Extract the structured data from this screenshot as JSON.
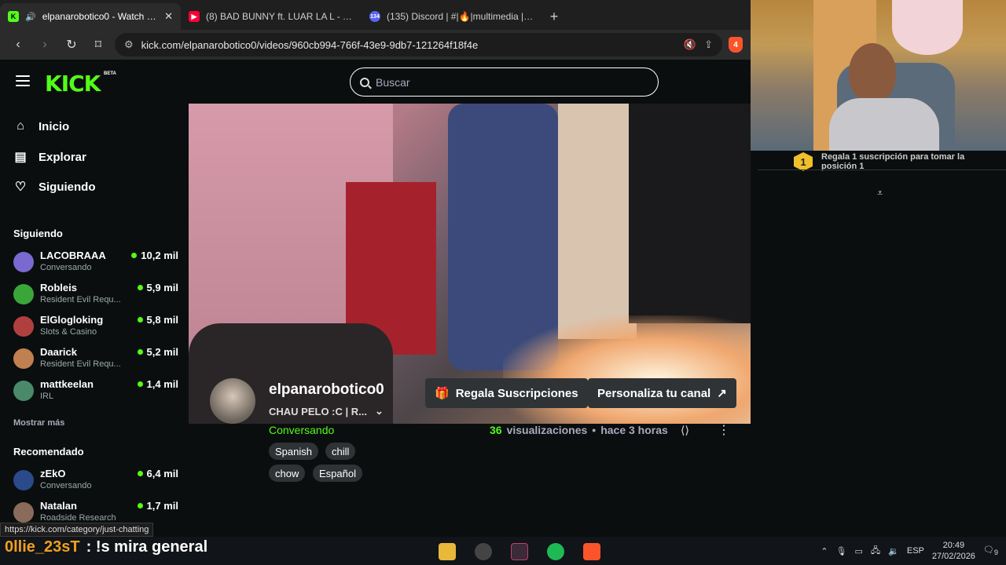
{
  "browser": {
    "tabs": [
      {
        "title": "elpanarobotico0 - Watch the",
        "favicon": "K",
        "favicon_color": "#53fc18",
        "active": true,
        "audio": true
      },
      {
        "title": "(8) BAD BUNNY ft. LUAR LA L - TELEF",
        "favicon": "▶",
        "favicon_color": "#ff0033",
        "active": false,
        "audio": false
      },
      {
        "title": "(135) Discord | #|🔥|multimedia | RO",
        "favicon": "134",
        "favicon_color": "#5865f2",
        "active": false,
        "audio": false
      }
    ],
    "url": "kick.com/elpanarobotico0/videos/960cb994-766f-43e9-9db7-121264f18f4e",
    "brave_badge": "4"
  },
  "kick": {
    "logo": "KICK",
    "logo_beta": "BETA",
    "search_placeholder": "Buscar",
    "nav": [
      {
        "label": "Inicio",
        "icon": "home-icon"
      },
      {
        "label": "Explorar",
        "icon": "explore-icon"
      },
      {
        "label": "Siguiendo",
        "icon": "heart-icon"
      }
    ],
    "following_title": "Siguiendo",
    "following": [
      {
        "name": "LACOBRAAA",
        "category": "Conversando",
        "viewers": "10,2 mil",
        "avatar_color": "#7a6ad0"
      },
      {
        "name": "Robleis",
        "category": "Resident Evil Requ...",
        "viewers": "5,9 mil",
        "avatar_color": "#3aa63a"
      },
      {
        "name": "ElGlogloking",
        "category": "Slots & Casino",
        "viewers": "5,8 mil",
        "avatar_color": "#b04040"
      },
      {
        "name": "Daarick",
        "category": "Resident Evil Requ...",
        "viewers": "5,2 mil",
        "avatar_color": "#c08050"
      },
      {
        "name": "mattkeelan",
        "category": "IRL",
        "viewers": "1,4 mil",
        "avatar_color": "#4a8a6a"
      }
    ],
    "show_more": "Mostrar más",
    "recommended_title": "Recomendado",
    "recommended": [
      {
        "name": "zEkO",
        "category": "Conversando",
        "viewers": "6,4 mil",
        "avatar_color": "#2a4a8a"
      },
      {
        "name": "Natalan",
        "category": "Roadside Research",
        "viewers": "1,7 mil",
        "avatar_color": "#8a6a5a"
      }
    ],
    "channel": {
      "name": "elpanarobotico0",
      "title": "CHAU PELO :C | R...",
      "category": "Conversando",
      "tags": [
        "Spanish",
        "chill",
        "chow",
        "Español"
      ],
      "gift_button": "Regala Suscripciones",
      "customize_button": "Personaliza tu canal",
      "views_count": "36",
      "views_label": "visualizaciones",
      "time_ago": "hace 3 horas"
    }
  },
  "overlay": {
    "rank": "1",
    "sub_text": "Regala 1 suscripción para tomar la posición 1",
    "chat_user": "0llie_23sT",
    "chat_message": ": !s mira general"
  },
  "status_url": "https://kick.com/category/just-chatting",
  "system": {
    "language": "ESP",
    "time": "20:49",
    "date": "27/02/2026",
    "notifications": "9"
  }
}
